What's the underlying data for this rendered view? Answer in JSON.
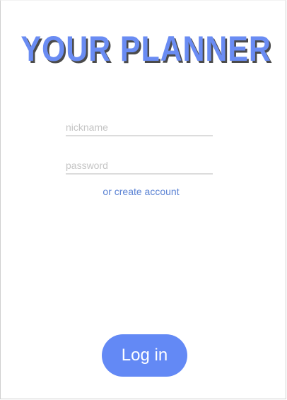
{
  "app": {
    "title": "YOUR PLANNER"
  },
  "form": {
    "nickname": {
      "placeholder": "nickname",
      "value": ""
    },
    "password": {
      "placeholder": "password",
      "value": ""
    },
    "create_account_label": "or create account",
    "login_label": "Log in"
  },
  "colors": {
    "accent": "#6389f5",
    "title": "#6a8cf3",
    "title_shadow": "#4b4b4b",
    "link": "#5d84d4",
    "underline": "#dcdcdc",
    "placeholder": "#c4c4c4"
  }
}
